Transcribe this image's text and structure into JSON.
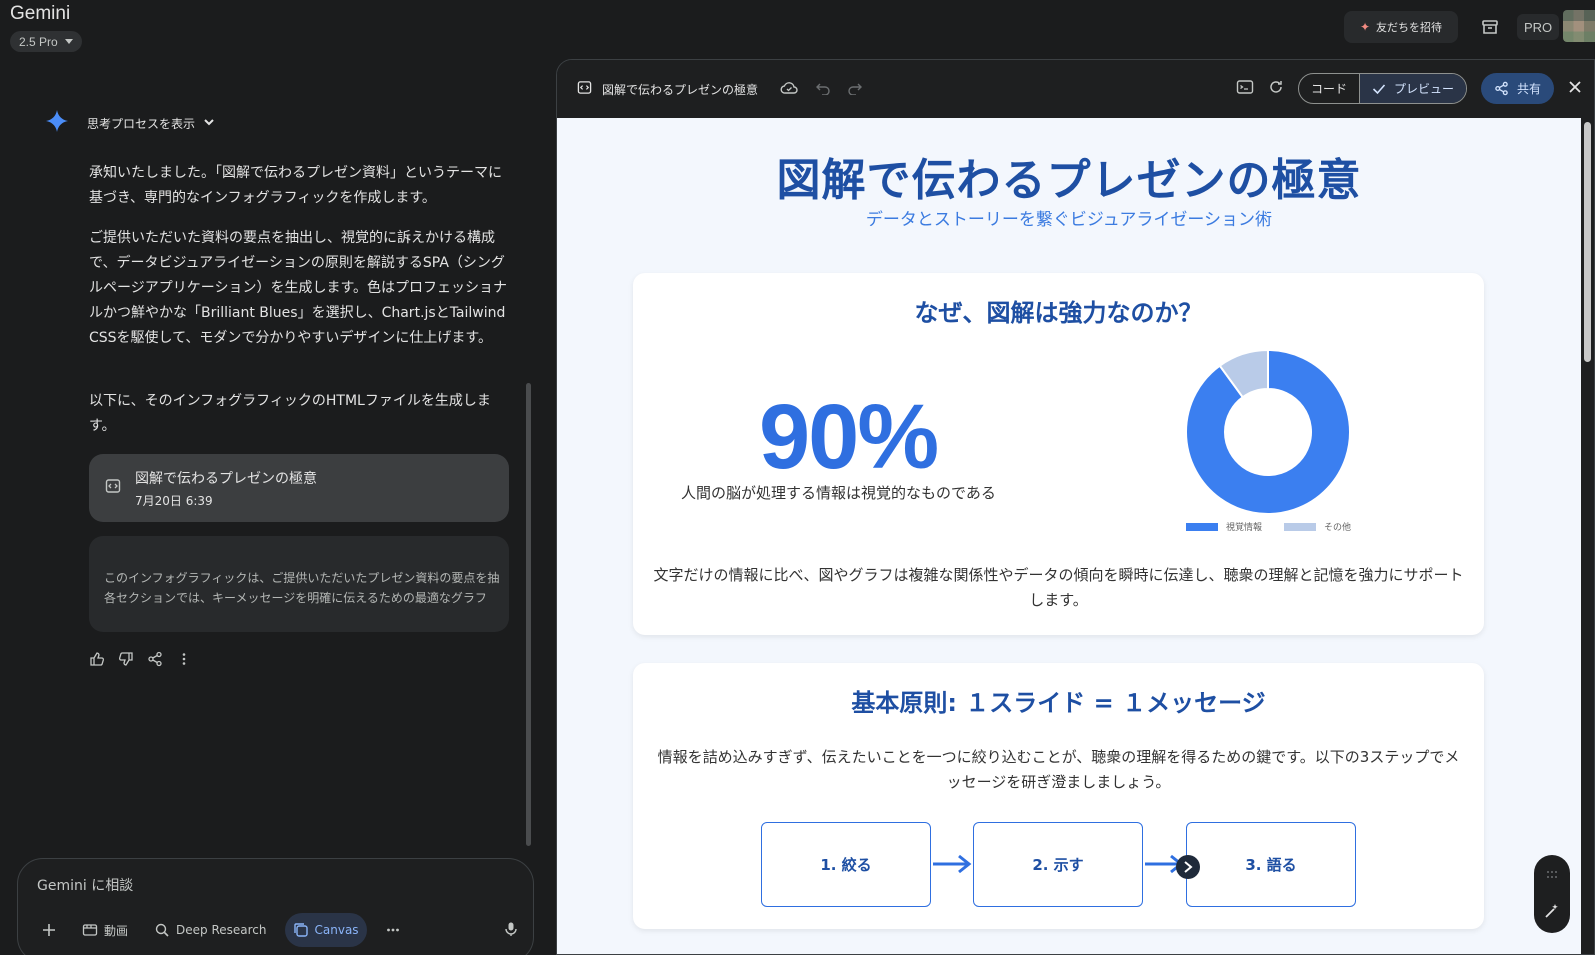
{
  "app": {
    "title": "Gemini",
    "model": "2.5 Pro"
  },
  "topbar": {
    "invite_label": "友だちを招待",
    "pro_label": "PRO"
  },
  "chat": {
    "thought_label": "思考プロセスを表示",
    "paragraphs": [
      "承知いたしました。「図解で伝わるプレゼン資料」というテーマに基づき、専門的なインフォグラフィックを作成します。",
      "ご提供いただいた資料の要点を抽出し、視覚的に訴えかける構成で、データビジュアライゼーションの原則を解説するSPA（シングルページアプリケーション）を生成します。色はプロフェッショナルかつ鮮やかな「Brilliant Blues」を選択し、Chart.jsとTailwind CSSを駆使して、モダンで分かりやすいデザインに仕上げます。",
      "以下に、そのインフォグラフィックのHTMLファイルを生成します。"
    ],
    "doc_card": {
      "title": "図解で伝わるプレゼンの極意",
      "date": "7月20日 6:39"
    },
    "summary_lines": [
      "このインフォグラフィックは、ご提供いただいたプレゼン資料の要点を抽",
      "各セクションでは、キーメッセージを明確に伝えるための最適なグラフ"
    ]
  },
  "composer": {
    "placeholder": "Gemini に相談",
    "tools": {
      "video": "動画",
      "deep_research": "Deep Research",
      "canvas": "Canvas"
    }
  },
  "canvas": {
    "title": "図解で伝わるプレゼンの極意",
    "code_label": "コード",
    "preview_label": "プレビュー",
    "share_label": "共有"
  },
  "preview": {
    "title": "図解で伝わるプレゼンの極意",
    "subtitle": "データとストーリーを繋ぐビジュアライゼーション術",
    "section1": {
      "heading": "なぜ、図解は強力なのか？",
      "big_number": "90%",
      "big_caption": "人間の脳が処理する情報は視覚的なものである",
      "body": "文字だけの情報に比べ、図やグラフは複雑な関係性やデータの傾向を瞬時に伝達し、聴衆の理解と記憶を強力にサポートします。"
    },
    "section2": {
      "heading": "基本原則: １スライド = １メッセージ",
      "body": "情報を詰め込みすぎず、伝えたいことを一つに絞り込むことが、聴衆の理解を得るための鍵です。以下の3ステップでメッセージを研ぎ澄ましましょう。",
      "steps": [
        "1. 絞る",
        "2. 示す",
        "3. 語る"
      ]
    }
  },
  "chart_data": {
    "type": "pie",
    "categories": [
      "視覚情報",
      "その他"
    ],
    "values": [
      90,
      10
    ],
    "colors": [
      "#3b7ff0",
      "#b9cbe8"
    ],
    "legend": "bottom"
  },
  "colors": {
    "accent": "#1e4fa3",
    "accent_light": "#2f6fe0"
  }
}
